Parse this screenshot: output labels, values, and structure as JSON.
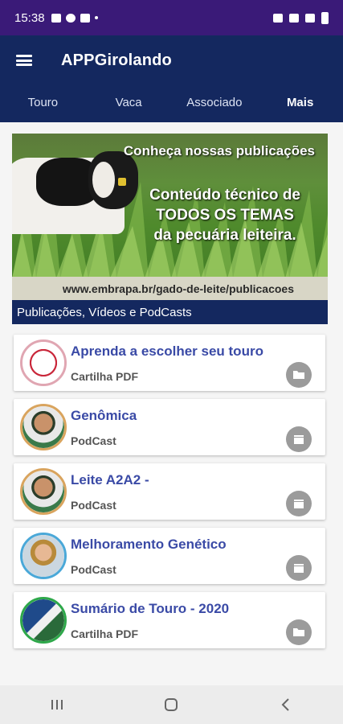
{
  "status_bar": {
    "time": "15:38"
  },
  "app": {
    "title": "APPGirolando"
  },
  "tabs": [
    {
      "label": "Touro",
      "active": false
    },
    {
      "label": "Vaca",
      "active": false
    },
    {
      "label": "Associado",
      "active": false
    },
    {
      "label": "Mais",
      "active": true
    }
  ],
  "banner": {
    "headline": "Conheça nossas publicações",
    "line1": "Conteúdo técnico de",
    "line2": "TODOS OS TEMAS",
    "line3": "da pecuária leiteira.",
    "url": "www.embrapa.br/gado-de-leite/publicacoes",
    "caption": "Publicações, Vídeos e PodCasts"
  },
  "items": [
    {
      "title": "Aprenda a escolher seu touro",
      "type": "Cartilha PDF",
      "icon": "folder-icon"
    },
    {
      "title": "Genômica",
      "type": "PodCast",
      "icon": "clapperboard-icon"
    },
    {
      "title": "Leite A2A2 -",
      "type": "PodCast",
      "icon": "clapperboard-icon"
    },
    {
      "title": "Melhoramento Genético",
      "type": "PodCast",
      "icon": "clapperboard-icon"
    },
    {
      "title": "Sumário de Touro - 2020",
      "type": "Cartilha PDF",
      "icon": "folder-icon"
    }
  ],
  "colors": {
    "status_bar": "#3a1a78",
    "app_bar": "#14285f",
    "title_text": "#3a4aa6",
    "action_button": "#9b9b9b"
  }
}
